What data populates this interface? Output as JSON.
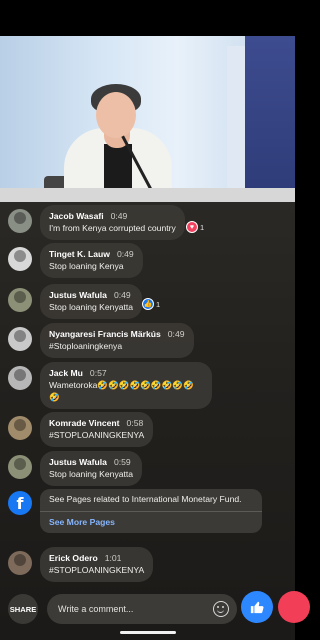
{
  "comments": [
    {
      "name": "Jacob Wasafi",
      "time": "0:49",
      "text": "I'm from Kenya corrupted country",
      "reaction": {
        "type": "love",
        "count": "1"
      }
    },
    {
      "name": "Tinget K. Lauw",
      "time": "0:49",
      "text": "Stop loaning Kenya"
    },
    {
      "name": "Justus Wafula",
      "time": "0:49",
      "text": "Stop loaning Kenyatta",
      "reaction": {
        "type": "like",
        "count": "1"
      }
    },
    {
      "name": "Nyangaresi Francis Märkús",
      "time": "0:49",
      "text": "#Stoploaningkenya"
    },
    {
      "name": "Jack Mu",
      "time": "0:57",
      "text": "Wametoroka🤣🤣🤣🤣🤣🤣🤣🤣🤣",
      "text2": "🤣"
    },
    {
      "name": "Komrade Vincent",
      "time": "0:58",
      "text": "#STOPLOANINGKENYA"
    },
    {
      "name": "Justus Wafula",
      "time": "0:59",
      "text": "Stop loaning Kenyatta"
    },
    {
      "name": "Erick Odero",
      "time": "1:01",
      "text": "#STOPLOANINGKENYA"
    }
  ],
  "pages_card": {
    "text": "See Pages related to International Monetary Fund.",
    "link": "See More Pages"
  },
  "composer": {
    "share_label": "SHARE",
    "placeholder": "Write a comment..."
  },
  "icons": {
    "like": "thumbs-up-icon",
    "love": "heart-icon",
    "emoji": "emoji-icon",
    "facebook": "facebook-logo-icon"
  },
  "colors": {
    "like_blue": "#2d88ff",
    "love_red": "#f33e58",
    "link_blue": "#86b6ff"
  }
}
